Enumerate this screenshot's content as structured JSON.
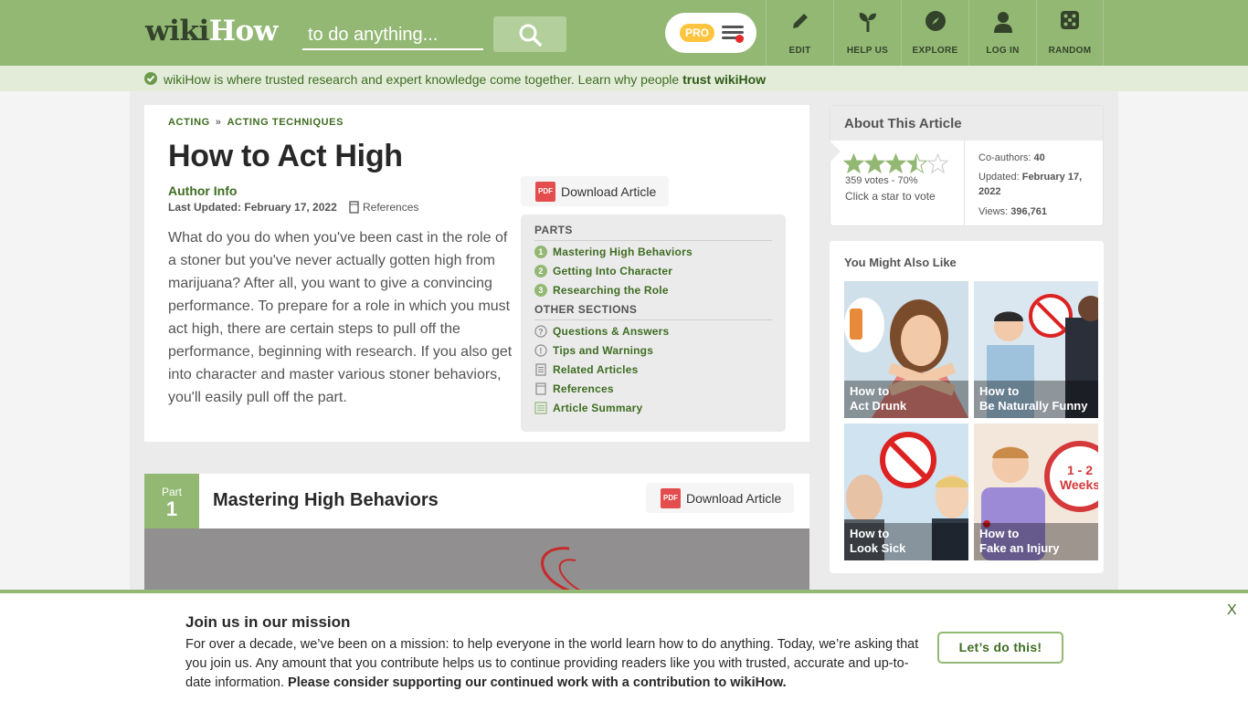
{
  "header": {
    "logo_part1": "wiki",
    "logo_part2": "How",
    "search_placeholder": "to do anything...",
    "pro_label": "PRO",
    "nav": [
      {
        "label": "EDIT",
        "icon": "pencil-icon"
      },
      {
        "label": "HELP US",
        "icon": "sprout-icon"
      },
      {
        "label": "EXPLORE",
        "icon": "compass-icon"
      },
      {
        "label": "LOG IN",
        "icon": "user-icon"
      },
      {
        "label": "RANDOM",
        "icon": "dice-icon"
      }
    ]
  },
  "trust_bar": {
    "text": "wikiHow is where trusted research and expert knowledge come together. Learn why people ",
    "link": "trust wikiHow"
  },
  "article": {
    "breadcrumb": [
      "ACTING",
      "ACTING TECHNIQUES"
    ],
    "breadcrumb_sep": "»",
    "title": "How to Act High",
    "author_link": "Author Info",
    "updated_label": "Last Updated:",
    "updated_date": "February 17, 2022",
    "references_link": "References",
    "download_label": "Download Article",
    "pdf_label": "PDF",
    "intro": "What do you do when you've been cast in the role of a stoner but you've never actually gotten high from marijuana? After all, you want to give a convincing performance. To prepare for a role in which you must act high, there are certain steps to pull off the performance, beginning with research. If you also get into character and master various stoner behaviors, you'll easily pull off the part."
  },
  "toc": {
    "parts_heading": "PARTS",
    "parts": [
      {
        "num": "1",
        "label": "Mastering High Behaviors"
      },
      {
        "num": "2",
        "label": "Getting Into Character"
      },
      {
        "num": "3",
        "label": "Researching the Role"
      }
    ],
    "other_heading": "OTHER SECTIONS",
    "other": [
      {
        "label": "Questions & Answers",
        "icon": "question-icon"
      },
      {
        "label": "Tips and Warnings",
        "icon": "exclamation-icon"
      },
      {
        "label": "Related Articles",
        "icon": "document-icon"
      },
      {
        "label": "References",
        "icon": "bookmark-icon"
      },
      {
        "label": "Article Summary",
        "icon": "list-icon"
      }
    ]
  },
  "part": {
    "word": "Part",
    "number": "1",
    "title": "Mastering High Behaviors",
    "download_label": "Download Article"
  },
  "about": {
    "heading": "About This Article",
    "rating": 3.5,
    "votes": "359 votes - 70%",
    "vote_hint": "Click a star to vote",
    "coauthors_label": "Co-authors:",
    "coauthors": "40",
    "updated_label": "Updated:",
    "updated": "February 17, 2022",
    "views_label": "Views:",
    "views": "396,761"
  },
  "you_might_like": {
    "heading": "You Might Also Like",
    "items": [
      {
        "prefix": "How to",
        "title": "Act Drunk"
      },
      {
        "prefix": "How to",
        "title": "Be Naturally Funny"
      },
      {
        "prefix": "How to",
        "title": "Look Sick"
      },
      {
        "prefix": "How to",
        "title": "Fake an Injury"
      }
    ],
    "injury_badge_top": "1 - 2",
    "injury_badge_bottom": "Weeks"
  },
  "banner": {
    "title": "Join us in our mission",
    "text": "For over a decade, we’ve been on a mission: to help everyone in the world learn how to do anything. Today, we’re asking that you join us. Any amount that you contribute helps us to continue providing readers like you with trusted, accurate and up-to-date information. ",
    "text_bold": "Please consider supporting our continued work with a contribution to wikiHow.",
    "button": "Let’s do this!",
    "close": "X"
  },
  "colors": {
    "brand_green": "#93b874",
    "link_green": "#3f6d22",
    "pro_yellow": "#ffc43e",
    "pdf_red": "#e44d4d"
  }
}
